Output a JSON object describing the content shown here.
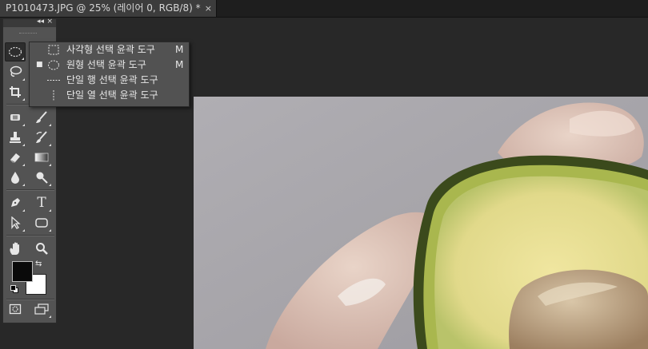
{
  "document_tab": {
    "title": "P1010473.JPG @ 25% (레이어 0, RGB/8) *",
    "close_glyph": "×"
  },
  "toolbox": {
    "collapse_glyph": "◂◂",
    "close_glyph": "×",
    "tools": [
      {
        "name": "elliptical-marquee-tool",
        "icon": "dashed-ellipse-icon"
      },
      {
        "name": "lasso-tool",
        "icon": "lasso-icon"
      },
      {
        "name": "crop-tool",
        "icon": "crop-icon"
      },
      {
        "name": "spot-healing-tool",
        "icon": "bandage-icon"
      },
      {
        "name": "brush-tool",
        "icon": "brush-icon"
      },
      {
        "name": "clone-stamp-tool",
        "icon": "stamp-icon"
      },
      {
        "name": "history-brush-tool",
        "icon": "history-brush-icon"
      },
      {
        "name": "eraser-tool",
        "icon": "eraser-icon"
      },
      {
        "name": "gradient-tool",
        "icon": "gradient-icon"
      },
      {
        "name": "blur-tool",
        "icon": "drop-icon"
      },
      {
        "name": "dodge-tool",
        "icon": "dodge-icon"
      },
      {
        "name": "pen-tool",
        "icon": "pen-icon"
      },
      {
        "name": "type-tool",
        "icon": "type-icon",
        "label": "T"
      },
      {
        "name": "path-selection-tool",
        "icon": "arrow-icon"
      },
      {
        "name": "shape-tool",
        "icon": "rounded-rect-icon"
      },
      {
        "name": "hand-tool",
        "icon": "hand-icon"
      },
      {
        "name": "zoom-tool",
        "icon": "magnifier-icon"
      }
    ],
    "foreground_color": "#0a0a0a",
    "background_color": "#ffffff"
  },
  "flyout": {
    "items": [
      {
        "label": "사각형 선택 윤곽 도구",
        "shortcut": "M",
        "selected": false
      },
      {
        "label": "원형 선택 윤곽 도구",
        "shortcut": "M",
        "selected": true
      },
      {
        "label": "단일 행 선택 윤곽 도구",
        "shortcut": "",
        "selected": false
      },
      {
        "label": "단일 열 선택 윤곽 도구",
        "shortcut": "",
        "selected": false
      }
    ],
    "selected_bullet": "■"
  }
}
